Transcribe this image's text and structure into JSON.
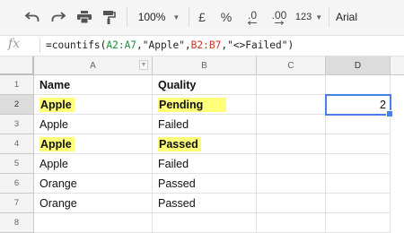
{
  "toolbar": {
    "zoom": "100%",
    "currency_label": "£",
    "percent_label": "%",
    "decrease_decimal_label": ".0",
    "increase_decimal_label": ".00",
    "more_formats_label": "123",
    "font": "Arial"
  },
  "formula_bar": {
    "fx_label": "fx",
    "parts": [
      "=countifs(",
      "A2:A7",
      ",\"Apple\",",
      "B2:B7",
      ",\"<>Failed\")"
    ]
  },
  "sheet": {
    "columns": [
      "A",
      "B",
      "C",
      "D"
    ],
    "rows": [
      "1",
      "2",
      "3",
      "4",
      "5",
      "6",
      "7",
      "8"
    ],
    "cells": [
      {
        "a": "Name",
        "b": "Quality",
        "d": ""
      },
      {
        "a": "Apple",
        "b": "Pending",
        "d": "2"
      },
      {
        "a": "Apple",
        "b": "Failed",
        "d": ""
      },
      {
        "a": "Apple",
        "b": "Passed",
        "d": ""
      },
      {
        "a": "Apple",
        "b": "Failed",
        "d": ""
      },
      {
        "a": "Orange",
        "b": "Passed",
        "d": ""
      },
      {
        "a": "Orange",
        "b": "Passed",
        "d": ""
      },
      {
        "a": "",
        "b": "",
        "d": ""
      }
    ],
    "selected_cell": "D2",
    "highlight_color": "#ffff7a",
    "selection_color": "#4a7fe6"
  }
}
